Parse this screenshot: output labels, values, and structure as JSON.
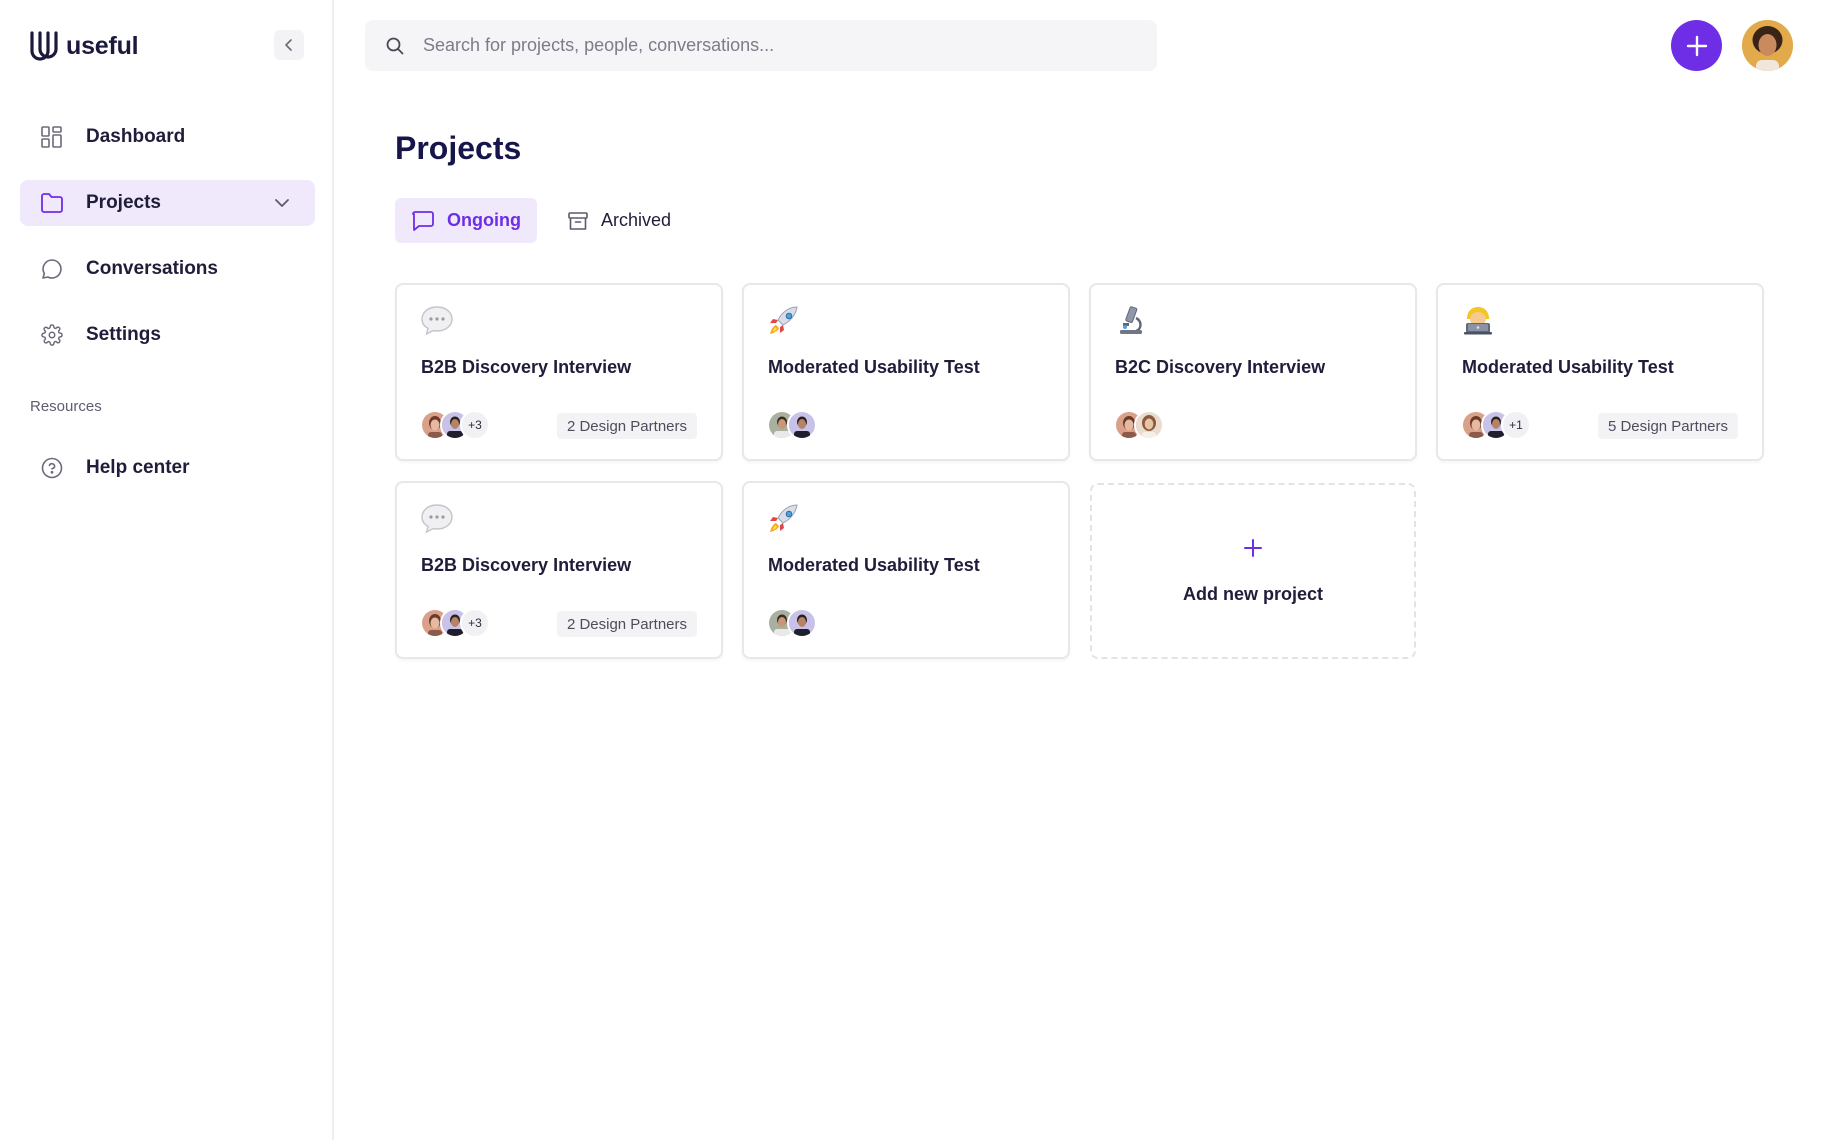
{
  "brand": {
    "name": "useful",
    "accent": "#6e2ee6"
  },
  "sidebar": {
    "items": [
      {
        "label": "Dashboard",
        "icon": "grid-icon"
      },
      {
        "label": "Projects",
        "icon": "folder-icon",
        "active": true
      },
      {
        "label": "Conversations",
        "icon": "chat-bubble-icon"
      },
      {
        "label": "Settings",
        "icon": "gear-icon"
      }
    ],
    "resources_label": "Resources",
    "resources": [
      {
        "label": "Help center",
        "icon": "help-circle-icon"
      }
    ]
  },
  "search": {
    "placeholder": "Search for projects, people, conversations..."
  },
  "main": {
    "title": "Projects",
    "tabs": [
      {
        "label": "Ongoing",
        "icon": "message-square-icon",
        "active": true
      },
      {
        "label": "Archived",
        "icon": "archive-box-icon",
        "active": false
      }
    ],
    "cards": [
      {
        "emoji": "speech-bubble",
        "title": "B2B Discovery Interview",
        "more": "+3",
        "partners": "2 Design Partners"
      },
      {
        "emoji": "rocket",
        "title": "Moderated Usability Test"
      },
      {
        "emoji": "microscope",
        "title": "B2C Discovery Interview"
      },
      {
        "emoji": "technologist",
        "title": "Moderated Usability Test",
        "more": "+1",
        "partners": "5 Design Partners"
      },
      {
        "emoji": "speech-bubble",
        "title": "B2B Discovery Interview",
        "more": "+3",
        "partners": "2 Design Partners"
      },
      {
        "emoji": "rocket",
        "title": "Moderated Usability Test"
      }
    ],
    "add_label": "Add new project"
  }
}
